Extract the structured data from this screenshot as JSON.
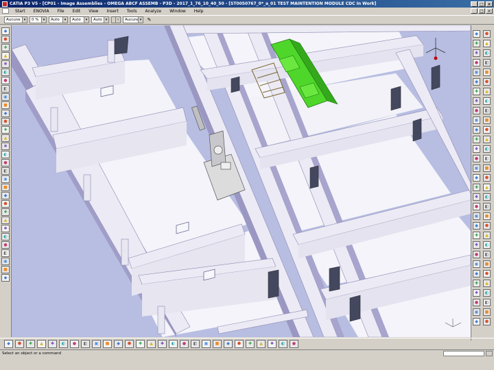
{
  "window": {
    "title": "CATIA P3 V5 - [CP01 - Image Assemblies - OMEGA ABCF ASSEMB - P3D - 2017_1_76_10_40_50 - [ST0050767_0*_a_01 TEST MAINTENTION MODULE CDC In Work]",
    "min": "_",
    "max": "□",
    "close": "×"
  },
  "menu": {
    "items": [
      "Start",
      "ENOVIA",
      "File",
      "Edit",
      "View",
      "Insert",
      "Tools",
      "Analyze",
      "Window",
      "Help"
    ]
  },
  "properties_toolbar": {
    "color": "Aucune",
    "transparency": "0 %",
    "line_thickness": "Auto",
    "line_type": "Auto",
    "point_type": "Auto",
    "layer": "Aucune"
  },
  "icons": {
    "left": [
      "select-icon",
      "fly-icon",
      "pan-icon",
      "rotate-icon",
      "zoom-icon",
      "spec-tree-icon",
      "part-icon",
      "product-icon",
      "constraint-icon",
      "manipulate-icon",
      "snap-icon",
      "explode-icon",
      "clash-icon",
      "section-icon",
      "measure-icon",
      "distance-icon",
      "annotation-icon",
      "layer-icon",
      "filter-icon",
      "scene-icon",
      "catalog-icon",
      "publish-icon",
      "enovia-icon",
      "compass-icon",
      "render-icon",
      "camera-icon",
      "light-icon",
      "viewpoint-icon",
      "grid-icon",
      "hide-show-icon",
      "properties-icon"
    ],
    "right": [
      "insert-component-icon",
      "new-product-icon",
      "new-part-icon",
      "existing-component-icon",
      "replace-icon",
      "graph-tree-icon",
      "renumber-icon",
      "reorder-icon",
      "reuse-pattern-icon",
      "multi-instantiation-icon",
      "fast-multi-icon",
      "bill-of-material-icon",
      "coincidence-icon",
      "contact-icon",
      "offset-icon",
      "angle-icon",
      "fix-icon",
      "fix-together-icon",
      "quick-constraint-icon",
      "flexible-icon",
      "change-constraint-icon",
      "reuse-constraint-icon",
      "update-icon",
      "split-icon",
      "hole-icon",
      "pocket-icon",
      "remove-icon",
      "add-icon",
      "symmetry-icon",
      "translation-icon",
      "rotation-icon",
      "scenes-icon",
      "enhanced-scene-icon",
      "annotation-text-icon",
      "flag-note-icon",
      "weld-icon",
      "sectioning-icon",
      "clash-analysis-icon",
      "distance-analysis-icon",
      "compute-clash-icon",
      "exploded-view-icon",
      "snapshot-icon",
      "catalog-browser-icon",
      "save-management-icon",
      "publication-icon",
      "kinematics-icon",
      "layout-icon",
      "positioning-icon",
      "mechanical-icon",
      "electrical-icon",
      "piping-icon",
      "hvac-icon",
      "structure-icon",
      "plant-icon",
      "equipment-icon",
      "tubing-icon",
      "raceway-icon",
      "conduit-icon",
      "fitting-icon",
      "hanger-icon",
      "support-icon",
      "valve-icon"
    ],
    "bottom": [
      "fit-all-icon",
      "pan-icon",
      "rotate-icon",
      "zoom-in-icon",
      "zoom-out-icon",
      "normal-view-icon",
      "multi-view-icon",
      "iso-view-icon",
      "shading-icon",
      "hide-icon",
      "swap-visible-icon",
      "fly-mode-icon",
      "turn-head-icon",
      "walk-icon",
      "collision-icon",
      "ground-icon",
      "magnifier-icon",
      "depth-effect-icon",
      "lighting-icon",
      "measure-between-icon",
      "measure-item-icon",
      "inertia-icon",
      "analysis-icon",
      "layer-filter-icon",
      "quick-select-icon",
      "selection-trap-icon",
      "update-all-icon"
    ]
  },
  "colors": {
    "viewport_bg": "#b8bee2",
    "floor": "#f4f4fa",
    "wall_top": "#eceaf4",
    "wall_side": "#9a98c2",
    "equipment_green": "#4fd62a",
    "door": "#44485e",
    "title_bar": "#0a246a",
    "chrome": "#d4d0c8"
  },
  "status": {
    "prompt": "Select an object or a command"
  }
}
